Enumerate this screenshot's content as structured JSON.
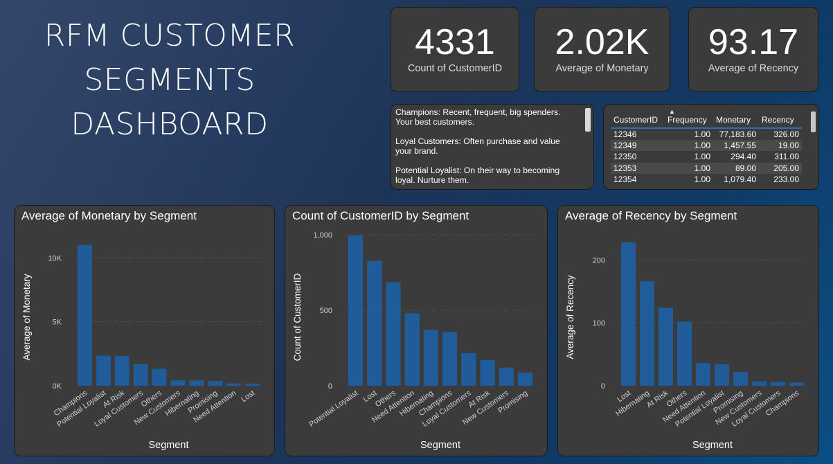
{
  "title": "RFM CUSTOMER SEGMENTS DASHBOARD",
  "kpis": [
    {
      "value": "4331",
      "label": "Count of CustomerID"
    },
    {
      "value": "2.02K",
      "label": "Average of Monetary"
    },
    {
      "value": "93.17",
      "label": "Average of Recency"
    }
  ],
  "descriptions": [
    "Champions: Recent, frequent, big spenders. Your best customers.",
    "Loyal Customers: Often purchase and value your brand.",
    "Potential Loyalist: On their way to becoming loyal. Nurture them."
  ],
  "table": {
    "headers": [
      "CustomerID",
      "Frequency",
      "Monetary",
      "Recency"
    ],
    "rows": [
      [
        "12346",
        "1.00",
        "77,183.60",
        "326.00"
      ],
      [
        "12349",
        "1.00",
        "1,457.55",
        "19.00"
      ],
      [
        "12350",
        "1.00",
        "294.40",
        "311.00"
      ],
      [
        "12353",
        "1.00",
        "89.00",
        "205.00"
      ],
      [
        "12354",
        "1.00",
        "1,079.40",
        "233.00"
      ]
    ]
  },
  "colors": {
    "bar": "#1f5c99",
    "panel": "#3b3b3b"
  },
  "chart_data": [
    {
      "type": "bar",
      "title": "Average of Monetary by Segment",
      "xlabel": "Segment",
      "ylabel": "Average of Monetary",
      "categories": [
        "Champions",
        "Potential Loyalist",
        "At Risk",
        "Loyal Customers",
        "Others",
        "New Customers",
        "Hibernating",
        "Promising",
        "Need Attention",
        "Lost"
      ],
      "values": [
        11000,
        2350,
        2330,
        1700,
        1320,
        430,
        420,
        370,
        190,
        170
      ],
      "ylim": [
        0,
        11800
      ],
      "yticks": [
        0,
        5000,
        10000
      ],
      "ytick_labels": [
        "0K",
        "5K",
        "10K"
      ]
    },
    {
      "type": "bar",
      "title": "Count of CustomerID by Segment",
      "xlabel": "Segment",
      "ylabel": "Count of CustomerID",
      "categories": [
        "Potential Loyalist",
        "Lost",
        "Others",
        "Need Attention",
        "Hibernating",
        "Champions",
        "Loyal Customers",
        "At Risk",
        "New Customers",
        "Promising"
      ],
      "values": [
        995,
        828,
        685,
        480,
        372,
        355,
        216,
        170,
        120,
        88
      ],
      "ylim": [
        0,
        1000
      ],
      "yticks": [
        0,
        500,
        1000
      ],
      "ytick_labels": [
        "0",
        "500",
        "1,000"
      ]
    },
    {
      "type": "bar",
      "title": "Average of Recency by Segment",
      "xlabel": "Segment",
      "ylabel": "Average of Recency",
      "categories": [
        "Lost",
        "Hibernating",
        "At Risk",
        "Others",
        "Need Attention",
        "Potential Loyalist",
        "Promising",
        "New Customers",
        "Loyal Customers",
        "Champions"
      ],
      "values": [
        228,
        166,
        124,
        102,
        36,
        34,
        22,
        7,
        6,
        5
      ],
      "ylim": [
        0,
        240
      ],
      "yticks": [
        0,
        100,
        200
      ],
      "ytick_labels": [
        "0",
        "100",
        "200"
      ]
    }
  ]
}
